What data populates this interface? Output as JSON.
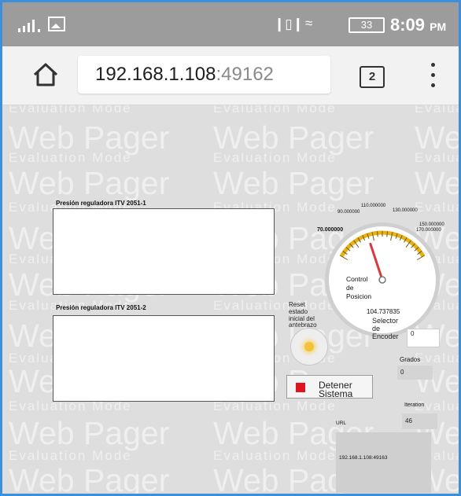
{
  "status_bar": {
    "battery": "33",
    "time": "8:09",
    "ampm": "PM"
  },
  "browser": {
    "url_host": "192.168.1.108",
    "url_port": ":49162",
    "tab_count": "2"
  },
  "watermark": {
    "big": "Web Pager",
    "small": "Evaluation Mode"
  },
  "chart1": {
    "title": "Presión reguladora ITV 2051-1"
  },
  "chart2": {
    "title": "Presión reguladora ITV 2051-2"
  },
  "gauge": {
    "ticks": [
      "70.000000",
      "90.000000",
      "110.000000",
      "130.000000",
      "150.000000",
      "170.000000"
    ],
    "label_line1": "Control",
    "label_line2": "de",
    "label_line3": "Posicion",
    "value": "104.737835",
    "value_num": 104.737835,
    "min": 70,
    "max": 170
  },
  "reset": {
    "line1": "Reset",
    "line2": "estado",
    "line3": "inicial del",
    "line4": "antebrazo"
  },
  "selector": {
    "line1": "Selector",
    "line2": "de",
    "line3": "Encoder",
    "value": "0"
  },
  "grados": {
    "label": "Grados",
    "value": "0"
  },
  "stop_button": {
    "line1": "Detener",
    "line2": "Sistema"
  },
  "iteration": {
    "label": "Iteration",
    "value": "46"
  },
  "url_panel": {
    "label": "URL",
    "value": "192.168.1.108:49163"
  },
  "colors": {
    "frame_border": "#3d8fd9",
    "stop_red": "#e0141e",
    "needle": "#d63a3a",
    "gauge_arc": "#e8b012"
  }
}
